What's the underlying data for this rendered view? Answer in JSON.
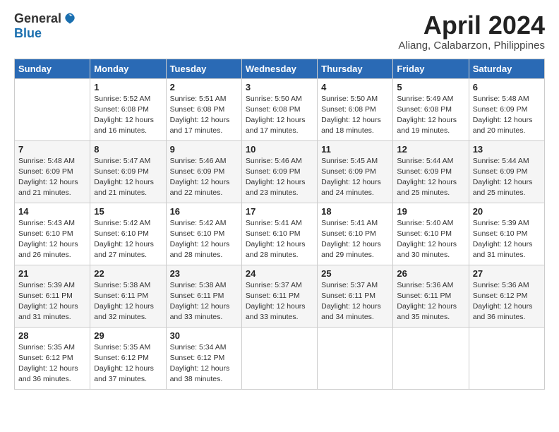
{
  "logo": {
    "general": "General",
    "blue": "Blue"
  },
  "title": "April 2024",
  "location": "Aliang, Calabarzon, Philippines",
  "days_of_week": [
    "Sunday",
    "Monday",
    "Tuesday",
    "Wednesday",
    "Thursday",
    "Friday",
    "Saturday"
  ],
  "weeks": [
    [
      {
        "day": "",
        "empty": true
      },
      {
        "day": "1",
        "sunrise": "5:52 AM",
        "sunset": "6:08 PM",
        "daylight": "12 hours and 16 minutes."
      },
      {
        "day": "2",
        "sunrise": "5:51 AM",
        "sunset": "6:08 PM",
        "daylight": "12 hours and 17 minutes."
      },
      {
        "day": "3",
        "sunrise": "5:50 AM",
        "sunset": "6:08 PM",
        "daylight": "12 hours and 17 minutes."
      },
      {
        "day": "4",
        "sunrise": "5:50 AM",
        "sunset": "6:08 PM",
        "daylight": "12 hours and 18 minutes."
      },
      {
        "day": "5",
        "sunrise": "5:49 AM",
        "sunset": "6:08 PM",
        "daylight": "12 hours and 19 minutes."
      },
      {
        "day": "6",
        "sunrise": "5:48 AM",
        "sunset": "6:09 PM",
        "daylight": "12 hours and 20 minutes."
      }
    ],
    [
      {
        "day": "7",
        "sunrise": "5:48 AM",
        "sunset": "6:09 PM",
        "daylight": "12 hours and 21 minutes."
      },
      {
        "day": "8",
        "sunrise": "5:47 AM",
        "sunset": "6:09 PM",
        "daylight": "12 hours and 21 minutes."
      },
      {
        "day": "9",
        "sunrise": "5:46 AM",
        "sunset": "6:09 PM",
        "daylight": "12 hours and 22 minutes."
      },
      {
        "day": "10",
        "sunrise": "5:46 AM",
        "sunset": "6:09 PM",
        "daylight": "12 hours and 23 minutes."
      },
      {
        "day": "11",
        "sunrise": "5:45 AM",
        "sunset": "6:09 PM",
        "daylight": "12 hours and 24 minutes."
      },
      {
        "day": "12",
        "sunrise": "5:44 AM",
        "sunset": "6:09 PM",
        "daylight": "12 hours and 25 minutes."
      },
      {
        "day": "13",
        "sunrise": "5:44 AM",
        "sunset": "6:09 PM",
        "daylight": "12 hours and 25 minutes."
      }
    ],
    [
      {
        "day": "14",
        "sunrise": "5:43 AM",
        "sunset": "6:10 PM",
        "daylight": "12 hours and 26 minutes."
      },
      {
        "day": "15",
        "sunrise": "5:42 AM",
        "sunset": "6:10 PM",
        "daylight": "12 hours and 27 minutes."
      },
      {
        "day": "16",
        "sunrise": "5:42 AM",
        "sunset": "6:10 PM",
        "daylight": "12 hours and 28 minutes."
      },
      {
        "day": "17",
        "sunrise": "5:41 AM",
        "sunset": "6:10 PM",
        "daylight": "12 hours and 28 minutes."
      },
      {
        "day": "18",
        "sunrise": "5:41 AM",
        "sunset": "6:10 PM",
        "daylight": "12 hours and 29 minutes."
      },
      {
        "day": "19",
        "sunrise": "5:40 AM",
        "sunset": "6:10 PM",
        "daylight": "12 hours and 30 minutes."
      },
      {
        "day": "20",
        "sunrise": "5:39 AM",
        "sunset": "6:10 PM",
        "daylight": "12 hours and 31 minutes."
      }
    ],
    [
      {
        "day": "21",
        "sunrise": "5:39 AM",
        "sunset": "6:11 PM",
        "daylight": "12 hours and 31 minutes."
      },
      {
        "day": "22",
        "sunrise": "5:38 AM",
        "sunset": "6:11 PM",
        "daylight": "12 hours and 32 minutes."
      },
      {
        "day": "23",
        "sunrise": "5:38 AM",
        "sunset": "6:11 PM",
        "daylight": "12 hours and 33 minutes."
      },
      {
        "day": "24",
        "sunrise": "5:37 AM",
        "sunset": "6:11 PM",
        "daylight": "12 hours and 33 minutes."
      },
      {
        "day": "25",
        "sunrise": "5:37 AM",
        "sunset": "6:11 PM",
        "daylight": "12 hours and 34 minutes."
      },
      {
        "day": "26",
        "sunrise": "5:36 AM",
        "sunset": "6:11 PM",
        "daylight": "12 hours and 35 minutes."
      },
      {
        "day": "27",
        "sunrise": "5:36 AM",
        "sunset": "6:12 PM",
        "daylight": "12 hours and 36 minutes."
      }
    ],
    [
      {
        "day": "28",
        "sunrise": "5:35 AM",
        "sunset": "6:12 PM",
        "daylight": "12 hours and 36 minutes."
      },
      {
        "day": "29",
        "sunrise": "5:35 AM",
        "sunset": "6:12 PM",
        "daylight": "12 hours and 37 minutes."
      },
      {
        "day": "30",
        "sunrise": "5:34 AM",
        "sunset": "6:12 PM",
        "daylight": "12 hours and 38 minutes."
      },
      {
        "day": "",
        "empty": true
      },
      {
        "day": "",
        "empty": true
      },
      {
        "day": "",
        "empty": true
      },
      {
        "day": "",
        "empty": true
      }
    ]
  ],
  "labels": {
    "sunrise": "Sunrise:",
    "sunset": "Sunset:",
    "daylight": "Daylight:"
  }
}
